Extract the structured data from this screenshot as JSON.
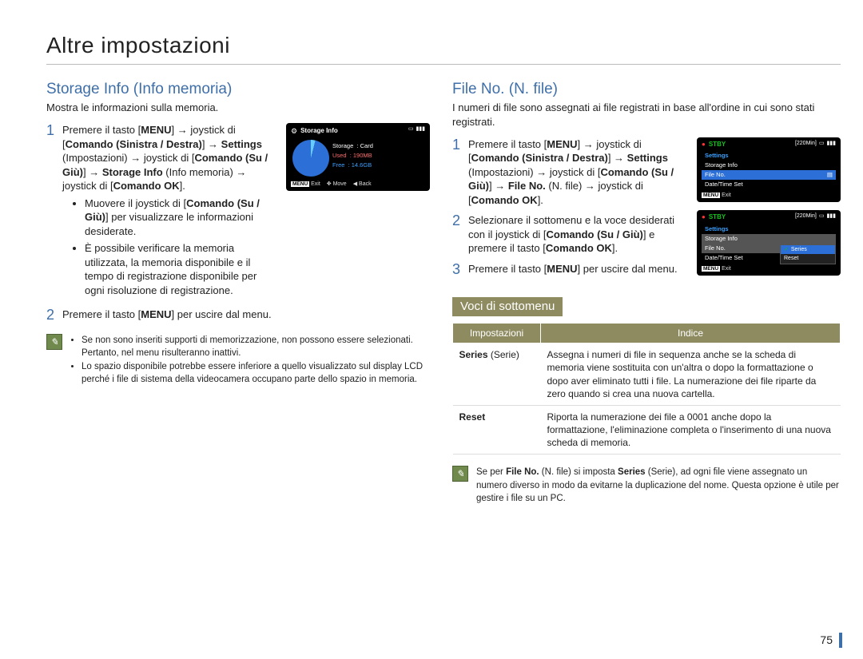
{
  "page_title": "Altre impostazioni",
  "page_number": "75",
  "left": {
    "heading": "Storage Info (Info memoria)",
    "desc": "Mostra le informazioni sulla memoria.",
    "step1_a": "Premere il tasto [",
    "step1_menu": "MENU",
    "step1_b": "] → joystick di [",
    "step1_c": "Comando (Sinistra / Destra)",
    "step1_d": "] → ",
    "step1_e": "Settings",
    "step1_f": " (Impostazioni) → joystick di [",
    "step1_g": "Comando (Su / Giù)",
    "step1_h": "] → ",
    "step1_i": "Storage Info",
    "step1_j": " (Info memoria) → joystick di [",
    "step1_k": "Comando OK",
    "step1_l": "].",
    "bullet1_a": "Muovere il joystick di [",
    "bullet1_b": "Comando (Su / Giù)",
    "bullet1_c": "] per visualizzare le informazioni desiderate.",
    "bullet2": "È possibile verificare la memoria utilizzata, la memoria disponibile e il tempo di registrazione disponibile per ogni risoluzione di registrazione.",
    "step2_a": "Premere il tasto [",
    "step2_b": "MENU",
    "step2_c": "] per uscire dal menu.",
    "note1": "Se non sono inseriti supporti di memorizzazione, non possono essere selezionati. Pertanto, nel menu risulteranno inattivi.",
    "note2": "Lo spazio disponibile potrebbe essere inferiore a quello visualizzato sul display LCD perché i file di sistema della videocamera occupano parte dello spazio in memoria.",
    "screen": {
      "title": "Storage Info",
      "storage_k": "Storage",
      "storage_v": ": Card",
      "used_k": "Used",
      "used_v": ": 190MB",
      "free_k": "Free",
      "free_v": ": 14.6GB",
      "exit": "Exit",
      "move": "Move",
      "back": "Back"
    }
  },
  "right": {
    "heading": "File No. (N. file)",
    "desc": "I numeri di file sono assegnati ai file registrati in base all'ordine in cui sono stati registrati.",
    "step1_a": "Premere il tasto [",
    "step1_menu": "MENU",
    "step1_b": "] → joystick di [",
    "step1_c": "Comando (Sinistra / Destra)",
    "step1_d": "] → ",
    "step1_e": "Settings",
    "step1_f": " (Impostazioni) → joystick di [",
    "step1_g": "Comando (Su / Giù)",
    "step1_h": "] → ",
    "step1_i": "File No.",
    "step1_j": " (N. file) → joystick di [",
    "step1_k": "Comando OK",
    "step1_l": "].",
    "step2": "Selezionare il sottomenu e la voce desiderati con il joystick di [",
    "step2_b": "Comando (Su / Giù)",
    "step2_c": "] e premere il tasto [",
    "step2_d": "Comando OK",
    "step2_e": "].",
    "step3_a": "Premere il tasto [",
    "step3_b": "MENU",
    "step3_c": "] per uscire dal menu.",
    "submenu_title": "Voci di sottomenu",
    "th1": "Impostazioni",
    "th2": "Indice",
    "row1_name_a": "Series",
    "row1_name_b": " (Serie)",
    "row1_desc": "Assegna i numeri di file in sequenza anche se la scheda di memoria viene sostituita con un'altra o dopo la formattazione o dopo aver eliminato tutti i file. La numerazione dei file riparte da zero quando si crea una nuova cartella.",
    "row2_name": "Reset",
    "row2_desc": "Riporta la numerazione dei file a 0001 anche dopo la formattazione, l'eliminazione completa o l'inserimento di una nuova scheda di memoria.",
    "note_a": "Se per ",
    "note_b": "File No.",
    "note_c": " (N. file) si imposta ",
    "note_d": "Series",
    "note_e": " (Serie), ad ogni file viene assegnato un numero diverso in modo da evitarne la duplicazione del nome. Questa opzione è utile per gestire i file su un PC.",
    "screen": {
      "stby": "STBY",
      "time": "[220Min]",
      "settings": "Settings",
      "storage_info": "Storage Info",
      "file_no": "File No.",
      "date_time": "Date/Time Set",
      "exit": "Exit",
      "series": "Series",
      "reset": "Reset"
    }
  }
}
